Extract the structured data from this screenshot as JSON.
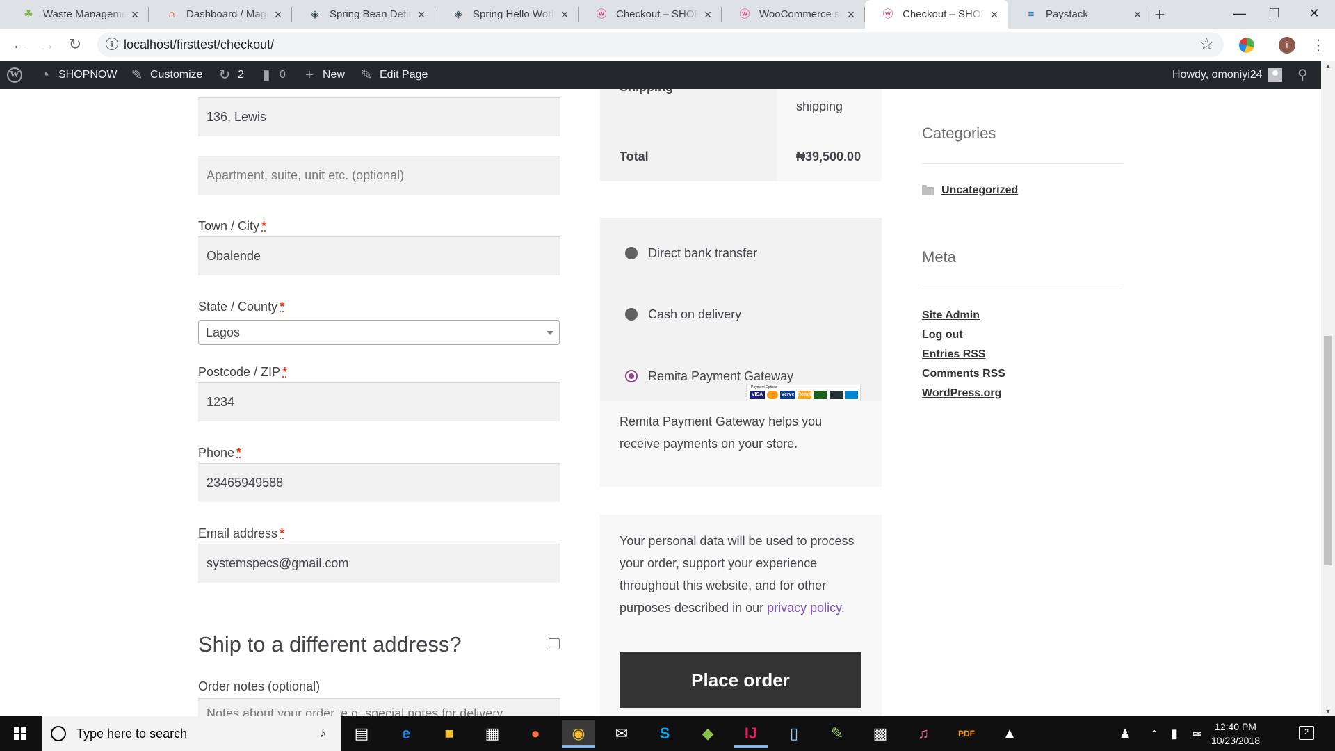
{
  "browser": {
    "tabs": [
      {
        "title": "Waste Management",
        "icon": "leaf-icon",
        "color": "#7cb342"
      },
      {
        "title": "Dashboard / Magento Admin",
        "icon": "magento-icon",
        "color": "#e64a19"
      },
      {
        "title": "Spring Bean Definition",
        "icon": "diamond-icon",
        "color": "#37474f"
      },
      {
        "title": "Spring Hello World",
        "icon": "diamond-icon",
        "color": "#37474f"
      },
      {
        "title": "Checkout – SHOPNOW",
        "icon": "woocommerce-icon",
        "color": "#d81b60"
      },
      {
        "title": "WooCommerce settings",
        "icon": "woocommerce-icon",
        "color": "#d81b60"
      },
      {
        "title": "Checkout – SHOPNOW",
        "icon": "woocommerce-icon",
        "color": "#d81b60"
      },
      {
        "title": "Paystack",
        "icon": "paystack-icon",
        "color": "#1e88e5"
      }
    ],
    "active_tab": 6,
    "url": "localhost/firsttest/checkout/",
    "profile_initial": "i"
  },
  "adminbar": {
    "site": "SHOPNOW",
    "customize": "Customize",
    "updates": "2",
    "comments": "0",
    "new": "New",
    "edit": "Edit Page",
    "howdy": "Howdy, omoniyi24"
  },
  "billing": {
    "street": "136, Lewis",
    "apartment_placeholder": "Apartment, suite, unit etc. (optional)",
    "city_label": "Town / City",
    "city": "Obalende",
    "state_label": "State / County",
    "state": "Lagos",
    "postcode_label": "Postcode / ZIP",
    "postcode": "1234",
    "phone_label": "Phone",
    "phone": "23465949588",
    "email_label": "Email address",
    "email": "systemspecs@gmail.com",
    "required_mark": "*",
    "ship_heading": "Ship to a different address?",
    "notes_label": "Order notes (optional)",
    "notes_placeholder": "Notes about your order, e.g. special notes for delivery."
  },
  "review": {
    "shipping_partial": "Shipping",
    "shipping_value": "shipping",
    "total_label": "Total",
    "total_value": "₦39,500.00"
  },
  "payment": {
    "methods": [
      "Direct bank transfer",
      "Cash on delivery",
      "Remita Payment Gateway"
    ],
    "selected": 2,
    "logos_caption": "Payment Options",
    "logos": [
      "VISA",
      "MC",
      "Verve",
      "Remita",
      "",
      "",
      ""
    ],
    "description": "Remita Payment Gateway helps you receive payments on your store."
  },
  "privacy": {
    "text": "Your personal data will be used to process your order, support your experience throughout this website, and for other purposes described in our",
    "link": "privacy policy",
    "end": "."
  },
  "place_order": "Place order",
  "sidebar": {
    "categories_title": "Categories",
    "categories": [
      "Uncategorized"
    ],
    "meta_title": "Meta",
    "meta_links": [
      "Site Admin",
      "Log out",
      "Entries RSS",
      "Comments RSS",
      "WordPress.org"
    ]
  },
  "taskbar": {
    "search_placeholder": "Type here to search",
    "time": "12:40 PM",
    "date": "10/23/2018",
    "notifications": "2"
  }
}
